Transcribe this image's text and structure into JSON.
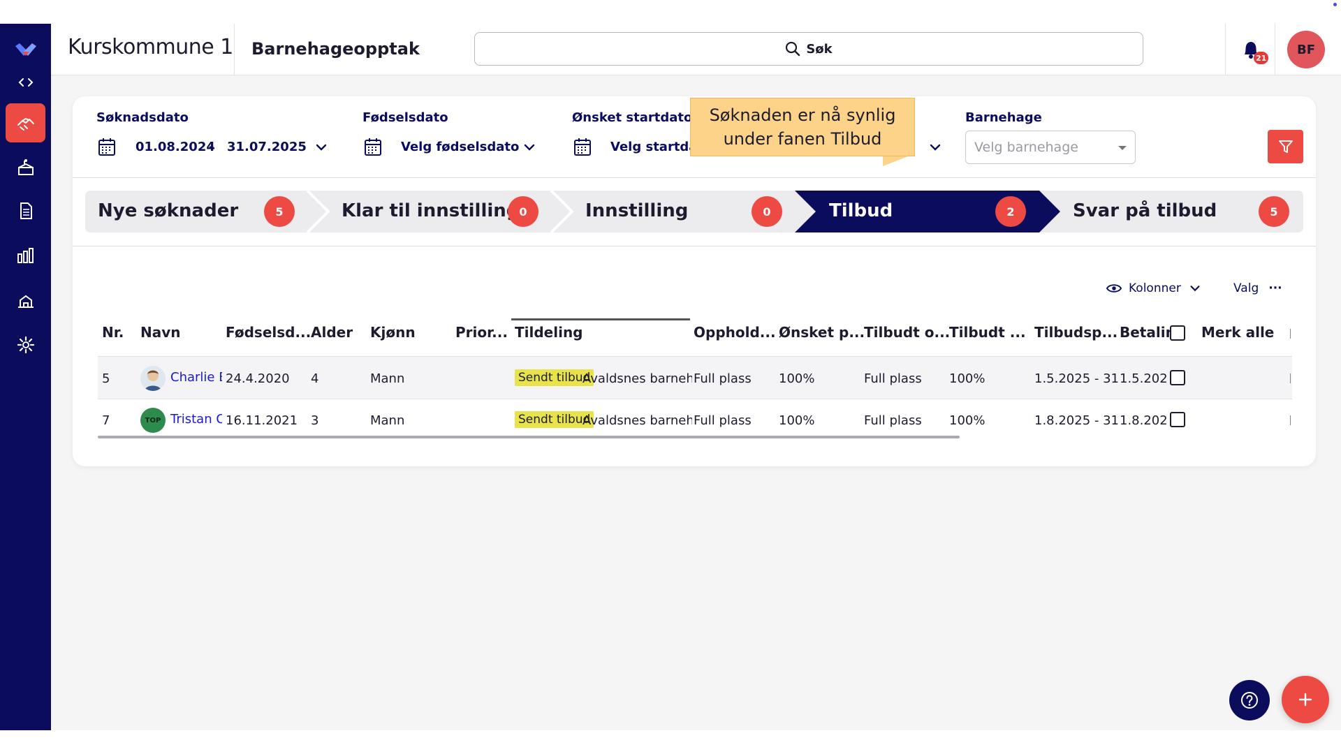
{
  "app": {
    "org_title": "Kurskommune 1",
    "module_title": "Barnehageopptak",
    "search_label": "Søk",
    "notification_count": "21",
    "user_initials": "BF"
  },
  "colors": {
    "sidebar": "#0b0c5c",
    "accent_red": "#ee4a44",
    "active_step": "#0b0c5c",
    "tag_yellow": "#e8e34a",
    "tooltip": "#fdd38a"
  },
  "sidebar": {
    "items": [
      {
        "icon": "code-brackets-icon"
      },
      {
        "icon": "handshake-icon",
        "active": true
      },
      {
        "icon": "kindergarten-icon"
      },
      {
        "icon": "document-icon"
      },
      {
        "icon": "bar-chart-icon"
      },
      {
        "icon": "building-icon"
      },
      {
        "icon": "gear-icon"
      }
    ]
  },
  "filters": {
    "application_date": {
      "label": "Søknadsdato",
      "from": "01.08.2024",
      "separator": "-",
      "to": "31.07.2025"
    },
    "birth_date": {
      "label": "Fødselsdato",
      "value": "Velg fødselsdato"
    },
    "start_date": {
      "label": "Ønsket startdato",
      "value": "Velg startdato"
    },
    "kindergarten": {
      "label": "Barnehage",
      "placeholder": "Velg barnehage"
    }
  },
  "tooltip": {
    "line1": "Søknaden er nå synlig",
    "line2": "under fanen Tilbud"
  },
  "steps": [
    {
      "label": "Nye søknader",
      "count": "5"
    },
    {
      "label": "Klar til innstilling",
      "count": "0"
    },
    {
      "label": "Innstilling",
      "count": "0"
    },
    {
      "label": "Tilbud",
      "count": "2",
      "active": true
    },
    {
      "label": "Svar på tilbud",
      "count": "5"
    }
  ],
  "table_tools": {
    "columns_label": "Kolonner",
    "options_label": "Valg",
    "options_dots": "···"
  },
  "table": {
    "headers": {
      "nr": "Nr.",
      "name": "Navn",
      "birth": "Fødselsd...",
      "age": "Alder",
      "gender": "Kjønn",
      "priority": "Prior...",
      "allocation": "Tildeling",
      "stay": "Opphold...",
      "wanted": "Ønsket p...",
      "offered_stay": "Tilbudt o...",
      "offered_pct": "Tilbudt ...",
      "offer_period": "Tilbudsp...",
      "payment": "Betalin",
      "mark_all": "Merk alle"
    },
    "rows": [
      {
        "nr": "5",
        "name": "Charlie B.(",
        "birth": "24.4.2020",
        "age": "4",
        "gender": "Mann",
        "status": "Sendt tilbud",
        "kindergarten": "Avaldsnes barnehage",
        "stay": "Full plass",
        "wanted": "100%",
        "offered_stay": "Full plass",
        "offered_pct": "100%",
        "offer_period": "1.5.2025 - 31.7.2025",
        "payment": "1.5.2025"
      },
      {
        "nr": "7",
        "name": "Tristan Os",
        "avatar_text": "TOP",
        "birth": "16.11.2021",
        "age": "3",
        "gender": "Mann",
        "status": "Sendt tilbud",
        "kindergarten": "Avaldsnes barnehage",
        "stay": "Full plass",
        "wanted": "100%",
        "offered_stay": "Full plass",
        "offered_pct": "100%",
        "offer_period": "1.8.2025 - 31.7.2",
        "payment": "1.8.2025"
      }
    ]
  }
}
